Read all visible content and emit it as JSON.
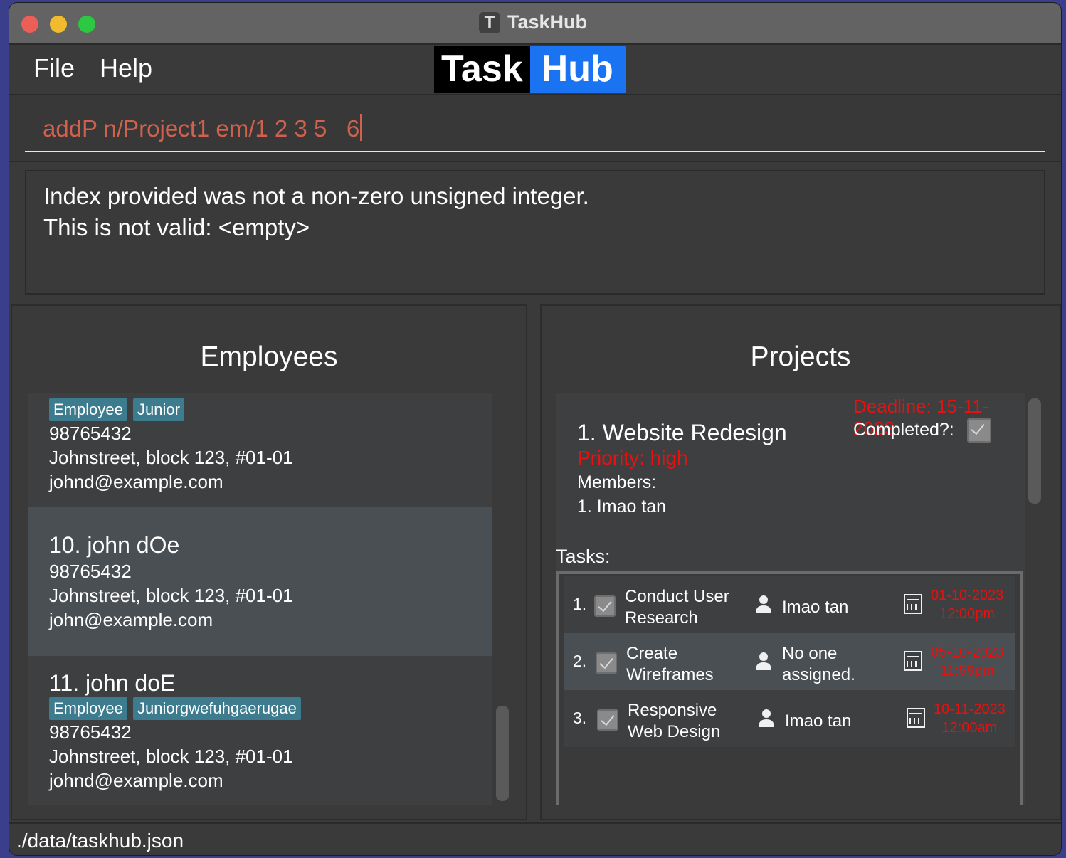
{
  "window": {
    "title": "TaskHub"
  },
  "menu": {
    "file": "File",
    "help": "Help"
  },
  "logo": {
    "part1": "Task",
    "part2": "Hub"
  },
  "command": {
    "value": "addP n/Project1 em/1 2 3 5   6"
  },
  "result": {
    "line1": "Index provided was not a non-zero unsigned integer.",
    "line2": "This is not valid: <empty>"
  },
  "employees": {
    "title": "Employees",
    "items": [
      {
        "name": "",
        "tags": [
          "Employee",
          "Junior"
        ],
        "phone": "98765432",
        "address": "Johnstreet, block 123, #01-01",
        "email": "johnd@example.com"
      },
      {
        "name": "10.  john dOe",
        "tags": [],
        "phone": "98765432",
        "address": "Johnstreet, block 123, #01-01",
        "email": "john@example.com"
      },
      {
        "name": "11.  john doE",
        "tags": [
          "Employee",
          "Juniorgwefuhgaerugae"
        ],
        "phone": "98765432",
        "address": "Johnstreet, block 123, #01-01",
        "email": "johnd@example.com"
      }
    ]
  },
  "projects": {
    "title": "Projects",
    "items": [
      {
        "name": "1.  Website Redesign",
        "priority": "Priority: high",
        "members_label": "Members:",
        "members": [
          "1. Imao tan"
        ],
        "deadline": "Deadline: 15-11-2023",
        "completed_label": "Completed?:",
        "completed": true,
        "tasks_label": "Tasks:",
        "tasks": [
          {
            "num": "1.",
            "line1": "Conduct User",
            "line2": "Research",
            "assignee1": "Imao tan",
            "assignee2": "",
            "date": "01-10-2023",
            "time": "12:00pm",
            "done": true
          },
          {
            "num": "2.",
            "line1": "Create",
            "line2": "Wireframes",
            "assignee1": "No one",
            "assignee2": "assigned.",
            "date": "05-10-2023",
            "time": "11:59pm",
            "done": true
          },
          {
            "num": "3.",
            "line1": "Responsive",
            "line2": "Web Design",
            "assignee1": "Imao tan",
            "assignee2": "",
            "date": "10-11-2023",
            "time": "12:00am",
            "done": true
          }
        ]
      }
    ]
  },
  "status": {
    "path": "./data/taskhub.json"
  },
  "colors": {
    "accent_red": "#e8110f",
    "tag_bg": "#3d7b8f",
    "logo_blue": "#1a73f0",
    "command_text": "#d0614d"
  },
  "icons": {
    "person": "person-icon",
    "calendar": "calendar-icon",
    "checkbox": "checkbox-checked-icon"
  }
}
